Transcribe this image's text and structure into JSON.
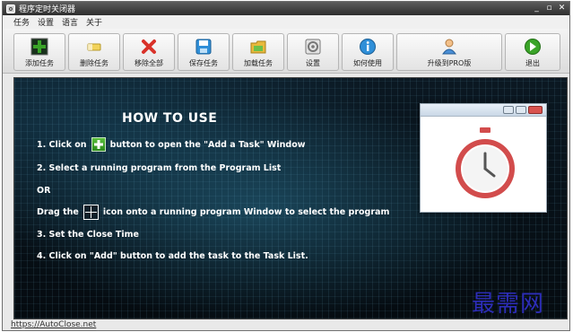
{
  "window": {
    "title": "程序定时关闭器",
    "controls": [
      "_",
      "▫",
      "✕"
    ]
  },
  "menu": [
    "任务",
    "设置",
    "语言",
    "关于"
  ],
  "toolbar": {
    "add_task": "添加任务",
    "delete_task": "删除任务",
    "remove_all": "移除全部",
    "save_task": "保存任务",
    "load_task": "加载任务",
    "settings": "设置",
    "how_to_use": "如何使用",
    "upgrade": "升级到PRO版",
    "exit": "退出"
  },
  "content": {
    "title": "HOW TO USE",
    "step1_pre": "1. Click on",
    "step1_post": "button to open the \"Add a Task\" Window",
    "step2": "2. Select a running program from the Program List",
    "or": "OR",
    "drag_pre": "Drag the",
    "drag_post": "icon onto a running program Window to select the program",
    "step3": "3. Set the Close Time",
    "step4": "4. Click on \"Add\" button to add the task to the Task List."
  },
  "footer": {
    "link": "https://AutoClose.net"
  },
  "watermark": "最需网",
  "colors": {
    "accent_green": "#3aa428",
    "delete_red": "#d9322a",
    "clock_red": "#d24c4c",
    "watermark_blue": "#2d2db8"
  }
}
